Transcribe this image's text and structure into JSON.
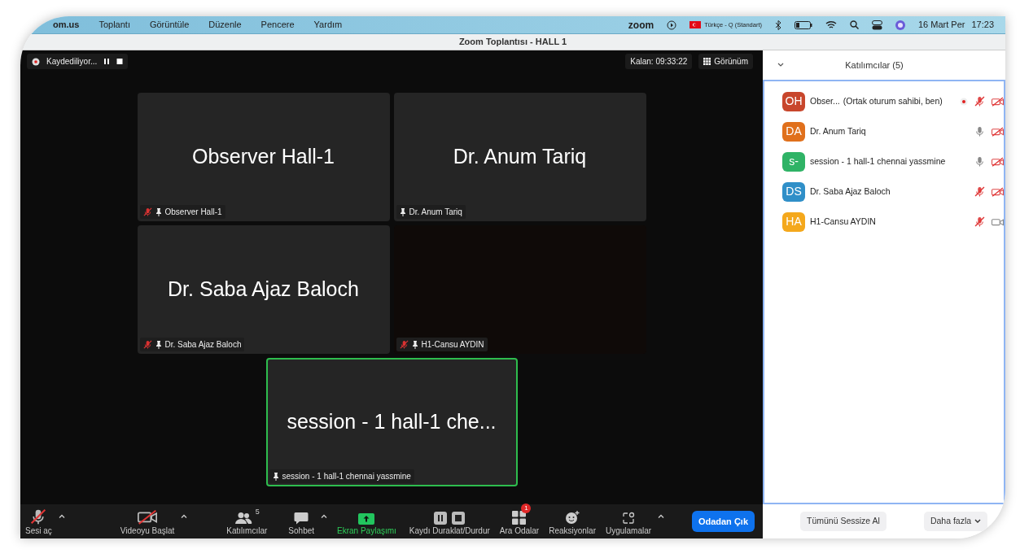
{
  "menubar": {
    "app": "om.us",
    "menus": [
      "Toplantı",
      "Görüntüle",
      "Düzenle",
      "Pencere",
      "Yardım"
    ],
    "logo": "zoom",
    "input_source": "Türkçe - Q (Standart)",
    "date": "16 Mart Per",
    "time": "17:23"
  },
  "window": {
    "title": "Zoom Toplantısı - HALL 1"
  },
  "recording": {
    "label": "Kaydediliyor..."
  },
  "remaining": "Kalan: 09:33:22",
  "view_button": "Görünüm",
  "tiles": [
    {
      "name": "Observer Hall-1",
      "label": "Observer Hall-1",
      "muted": true,
      "video_on": false,
      "active_speaker": false
    },
    {
      "name": "Dr. Anum Tariq",
      "label": "Dr. Anum Tariq",
      "muted": false,
      "video_on": false,
      "active_speaker": false
    },
    {
      "name": "Dr. Saba Ajaz Baloch",
      "label": "Dr. Saba Ajaz Baloch",
      "muted": true,
      "video_on": false,
      "active_speaker": false
    },
    {
      "label": "H1-Cansu AYDIN",
      "muted": true,
      "video_on": true,
      "active_speaker": false
    },
    {
      "name": "session - 1 hall-1 che...",
      "label": "session - 1 hall-1 chennai yassmine",
      "muted": false,
      "video_on": false,
      "active_speaker": true
    }
  ],
  "toolbar": [
    {
      "kind": "mic",
      "label": "Sesi aç",
      "off": true,
      "caret": true
    },
    {
      "kind": "video",
      "label": "Videoyu Başlat",
      "off": true,
      "caret": true
    },
    {
      "kind": "people",
      "label": "Katılımcılar",
      "count": "5",
      "caret": false
    },
    {
      "kind": "chat",
      "label": "Sohbet",
      "caret": true
    },
    {
      "kind": "share",
      "label": "Ekran Paylaşımı",
      "caret": false
    },
    {
      "kind": "record",
      "label": "Kaydı Duraklat/Durdur",
      "caret": false
    },
    {
      "kind": "rooms",
      "label": "Ara Odalar",
      "badge": "1",
      "caret": false
    },
    {
      "kind": "react",
      "label": "Reaksiyonlar",
      "caret": false
    },
    {
      "kind": "apps",
      "label": "Uygulamalar",
      "caret": true
    }
  ],
  "leave_button": "Odadan Çık",
  "panel": {
    "title": "Katılımcılar (5)",
    "participants": [
      {
        "initials": "OH",
        "color": "#c8462c",
        "name": "Obser...",
        "role": "(Ortak oturum sahibi, ben)",
        "recording": true,
        "mic_muted": true,
        "camera_off": true
      },
      {
        "initials": "DA",
        "color": "#e0701c",
        "name": "Dr. Anum Tariq",
        "recording": false,
        "mic_muted": false,
        "camera_off": true
      },
      {
        "initials": "s-",
        "color": "#2fb366",
        "name": "session - 1 hall-1 chennai yassmine",
        "recording": false,
        "mic_muted": false,
        "camera_off": true
      },
      {
        "initials": "DS",
        "color": "#2f8fc8",
        "name": "Dr. Saba Ajaz Baloch",
        "recording": false,
        "mic_muted": true,
        "camera_off": true
      },
      {
        "initials": "HA",
        "color": "#f4a81c",
        "name": "H1-Cansu AYDIN",
        "recording": false,
        "mic_muted": true,
        "camera_off": false
      }
    ],
    "mute_all": "Tümünü Sessize Al",
    "more": "Daha fazla"
  }
}
